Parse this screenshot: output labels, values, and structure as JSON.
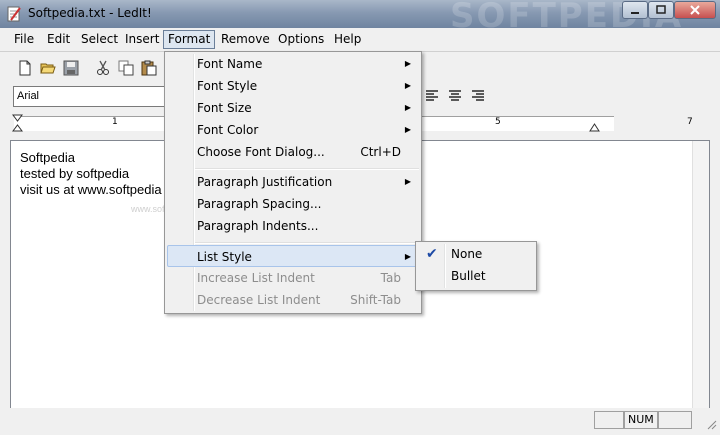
{
  "window": {
    "title": "Softpedia.txt - LedIt!",
    "watermark": "SOFTPEDIA"
  },
  "menubar": {
    "items": [
      "File",
      "Edit",
      "Select",
      "Insert",
      "Format",
      "Remove",
      "Options",
      "Help"
    ],
    "active": "Format"
  },
  "formatbar": {
    "font_name": "Arial"
  },
  "ruler": {
    "labels": [
      "1",
      "5",
      "7"
    ]
  },
  "document": {
    "lines": [
      "Softpedia",
      "tested by softpedia",
      "visit us at www.softpedia"
    ],
    "watermark": "www.softpedia.com"
  },
  "format_menu": {
    "items": [
      {
        "label": "Font Name",
        "submenu": true
      },
      {
        "label": "Font Style",
        "submenu": true
      },
      {
        "label": "Font Size",
        "submenu": true
      },
      {
        "label": "Font Color",
        "submenu": true
      },
      {
        "label": "Choose Font Dialog...",
        "shortcut": "Ctrl+D"
      },
      {
        "label": "Paragraph Justification",
        "submenu": true
      },
      {
        "label": "Paragraph Spacing..."
      },
      {
        "label": "Paragraph Indents..."
      },
      {
        "label": "List Style",
        "submenu": true,
        "highlighted": true
      },
      {
        "label": "Increase List Indent",
        "shortcut": "Tab",
        "disabled": true
      },
      {
        "label": "Decrease List Indent",
        "shortcut": "Shift-Tab",
        "disabled": true
      }
    ]
  },
  "list_style_menu": {
    "items": [
      {
        "label": "None",
        "checked": true
      },
      {
        "label": "Bullet"
      }
    ]
  },
  "statusbar": {
    "indicator": "NUM"
  },
  "colors": {
    "highlight": "#dce7f5",
    "check": "#1d4aa5",
    "menu_border": "#979797"
  }
}
